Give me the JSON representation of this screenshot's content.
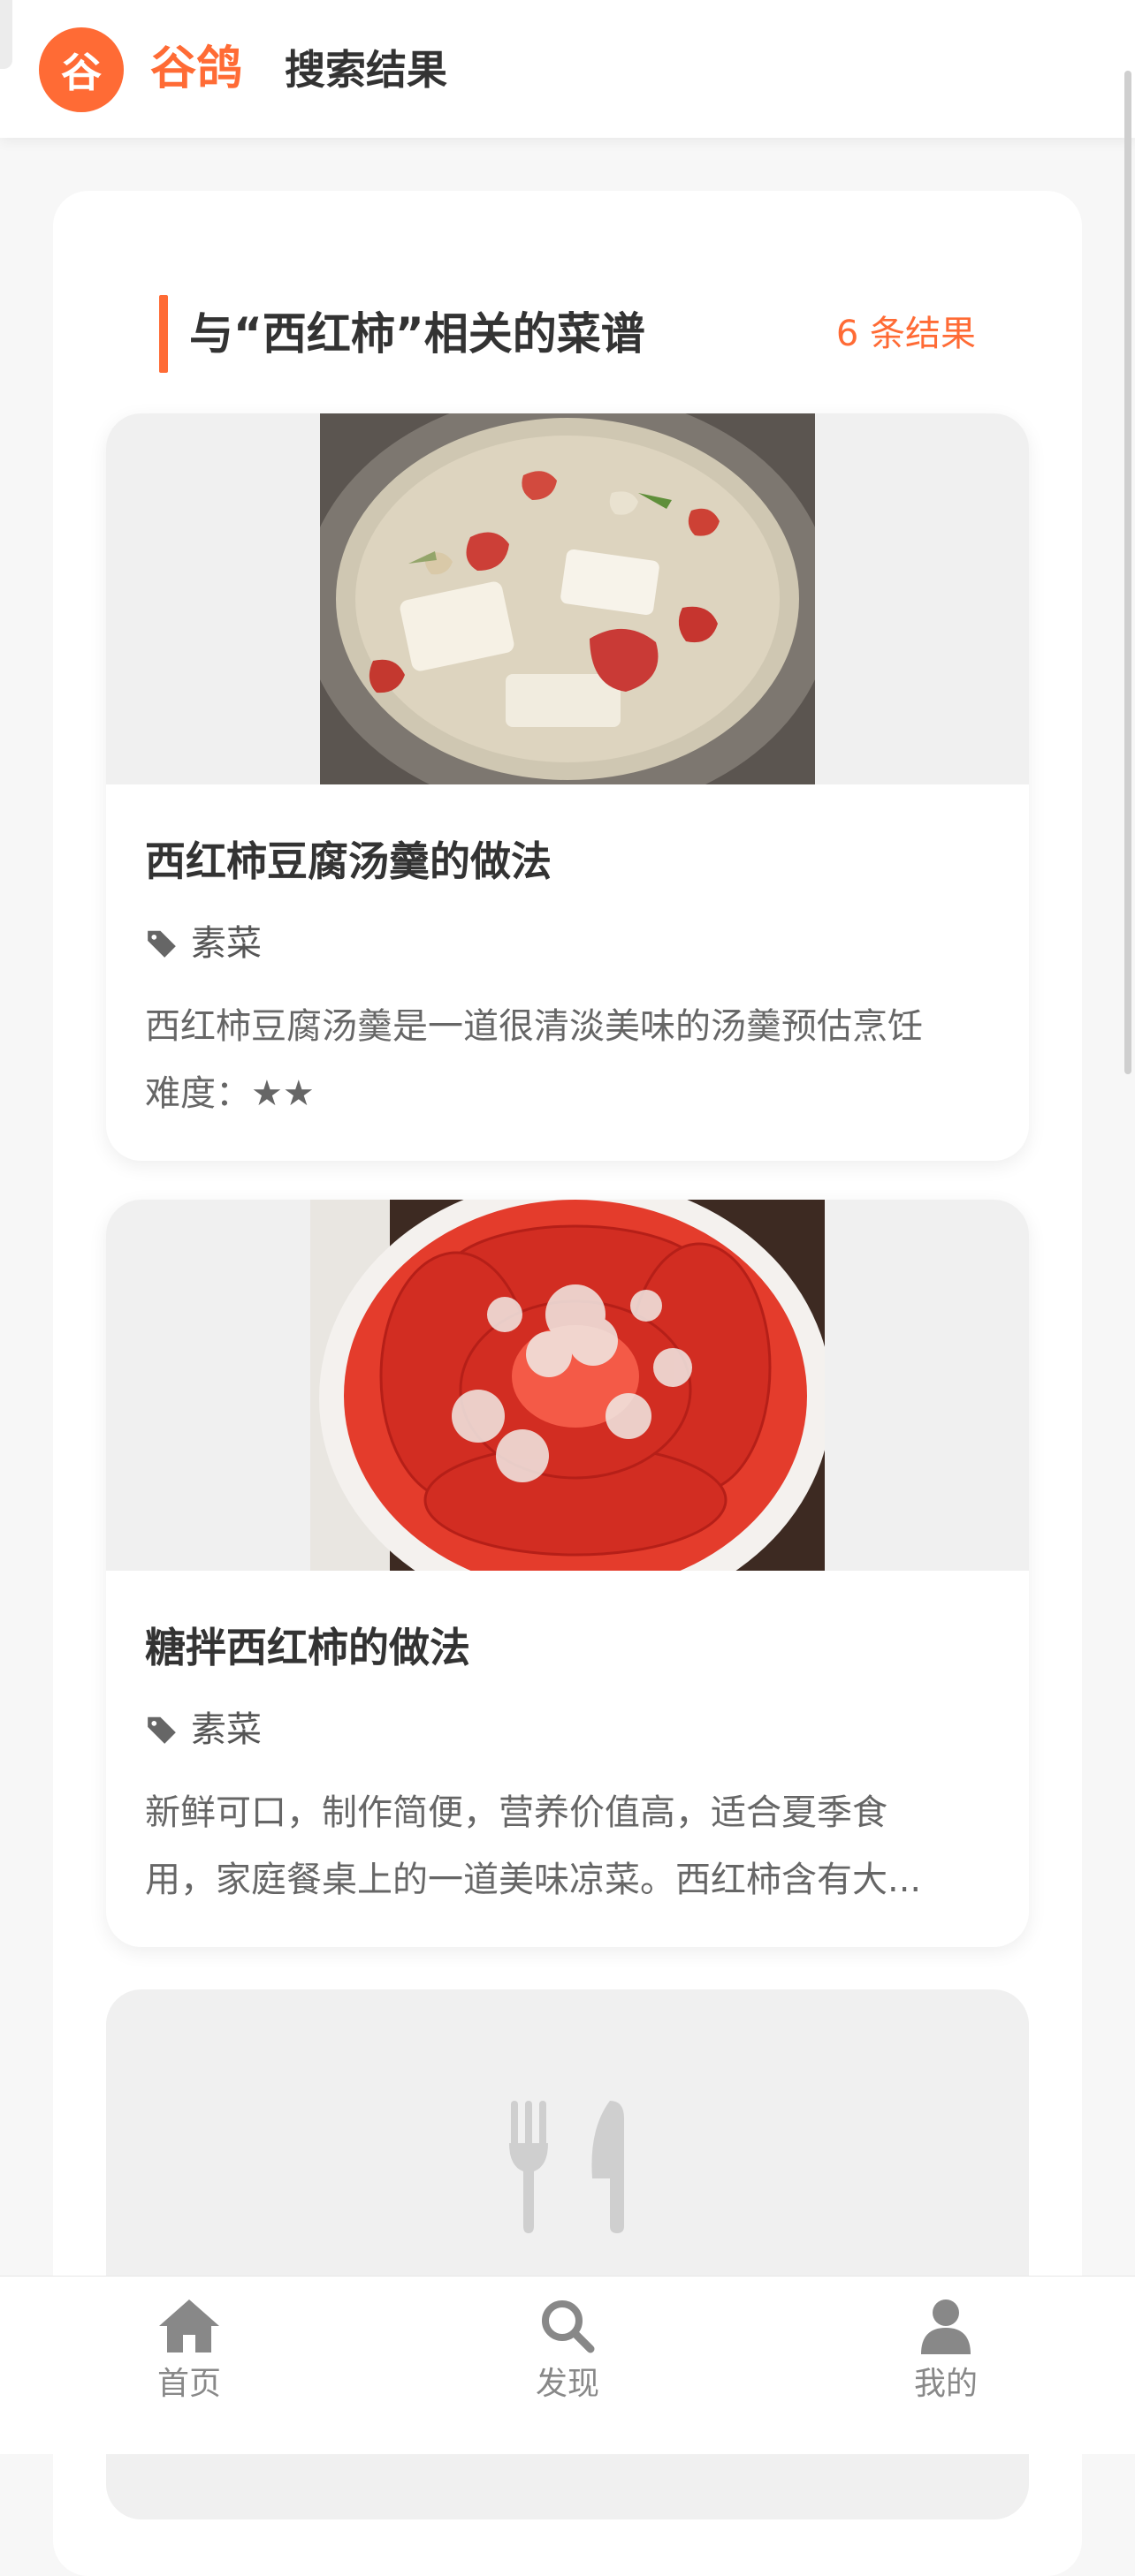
{
  "header": {
    "logo_char": "谷",
    "brand": "谷鸽",
    "title": "搜索结果"
  },
  "section": {
    "title": "与“西红柿”相关的菜谱",
    "count": "6 条结果"
  },
  "recipes": [
    {
      "title": "西红柿豆腐汤羹的做法",
      "tag": "素菜",
      "desc_line1": "西红柿豆腐汤羹是一道很清淡美味的汤羹预估烹饪",
      "desc_line2": "难度：★★"
    },
    {
      "title": "糖拌西红柿的做法",
      "tag": "素菜",
      "desc_line1": "新鲜可口，制作简便，营养价值高，适合夏季食",
      "desc_line2": "用，家庭餐桌上的一道美味凉菜。西红柿含有大..."
    }
  ],
  "bottom_nav": {
    "home": "首页",
    "discover": "发现",
    "mine": "我的"
  },
  "colors": {
    "accent": "#ff6b35",
    "text": "#333333",
    "muted": "#888888"
  },
  "icons": [
    "tag-icon",
    "utensils-icon",
    "home-icon",
    "search-icon",
    "user-icon"
  ]
}
